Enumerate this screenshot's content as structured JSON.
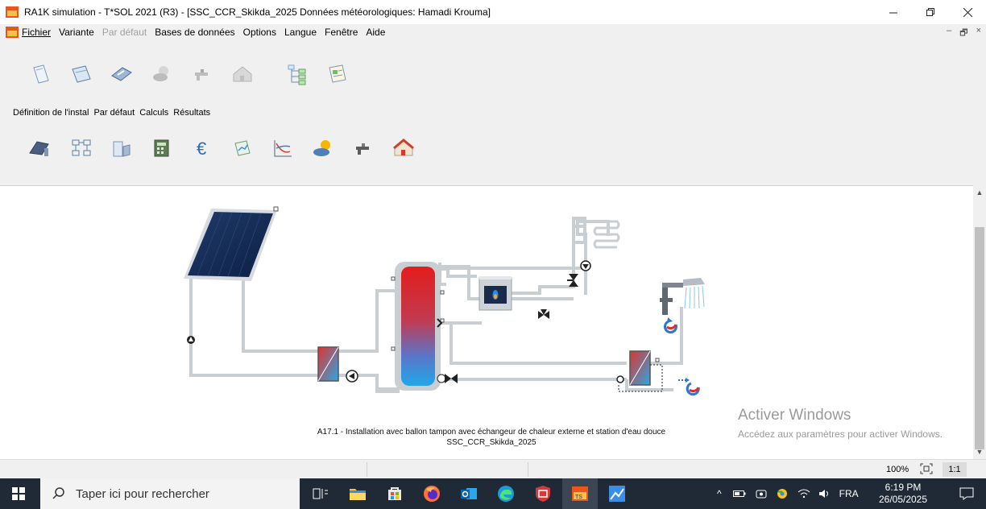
{
  "window": {
    "title": "RA1K simulation - T*SOL 2021 (R3) - [SSC_CCR_Skikda_2025    Données météorologiques: Hamadi Krouma]",
    "controls": [
      "minimize-icon",
      "restore-icon",
      "close-icon"
    ]
  },
  "menu": {
    "items": [
      {
        "label": "Fichier",
        "enabled": true
      },
      {
        "label": "Variante",
        "enabled": true
      },
      {
        "label": "Par défaut",
        "enabled": false
      },
      {
        "label": "Bases de données",
        "enabled": true
      },
      {
        "label": "Options",
        "enabled": true
      },
      {
        "label": "Langue",
        "enabled": true
      },
      {
        "label": "Fenêtre",
        "enabled": true
      },
      {
        "label": "Aide",
        "enabled": true
      }
    ],
    "mdi_controls": [
      "–",
      "🗗",
      "×"
    ]
  },
  "toolbar_top": {
    "icons": [
      "new-document-icon",
      "open-folder-icon",
      "save-disk-icon",
      "weather-disabled-icon",
      "tap-disabled-icon",
      "house-disabled-icon",
      "tree-structure-icon",
      "report-icon"
    ]
  },
  "subtabs": {
    "items": [
      "Définition de l'instal",
      "Par défaut",
      "Calculs",
      "Résultats"
    ]
  },
  "toolbar_bottom": {
    "icons": [
      "collector-icon",
      "system-diagram-icon",
      "tank-icon",
      "calculator-icon",
      "euro-icon",
      "graph-icon",
      "curve-chart-icon",
      "sun-cloud-icon",
      "tap-icon",
      "house-icon"
    ]
  },
  "diagram": {
    "caption_line1": "A17.1 - Installation avec ballon tampon avec échangeur de chaleur externe et station d'eau douce",
    "caption_line2": "SSC_CCR_Skikda_2025"
  },
  "watermark": {
    "line1": "Activer Windows",
    "line2": "Accédez aux paramètres pour activer Windows."
  },
  "statusbar": {
    "zoom": "100%",
    "ratio": "1:1"
  },
  "taskbar": {
    "search_placeholder": "Taper ici pour rechercher",
    "language": "FRA",
    "time": "6:19 PM",
    "date": "26/05/2025"
  },
  "colors": {
    "accent_red": "#e32b2b",
    "accent_blue": "#2ea3e0",
    "pipe": "#c9ced3",
    "taskbar": "#1f2a36"
  }
}
